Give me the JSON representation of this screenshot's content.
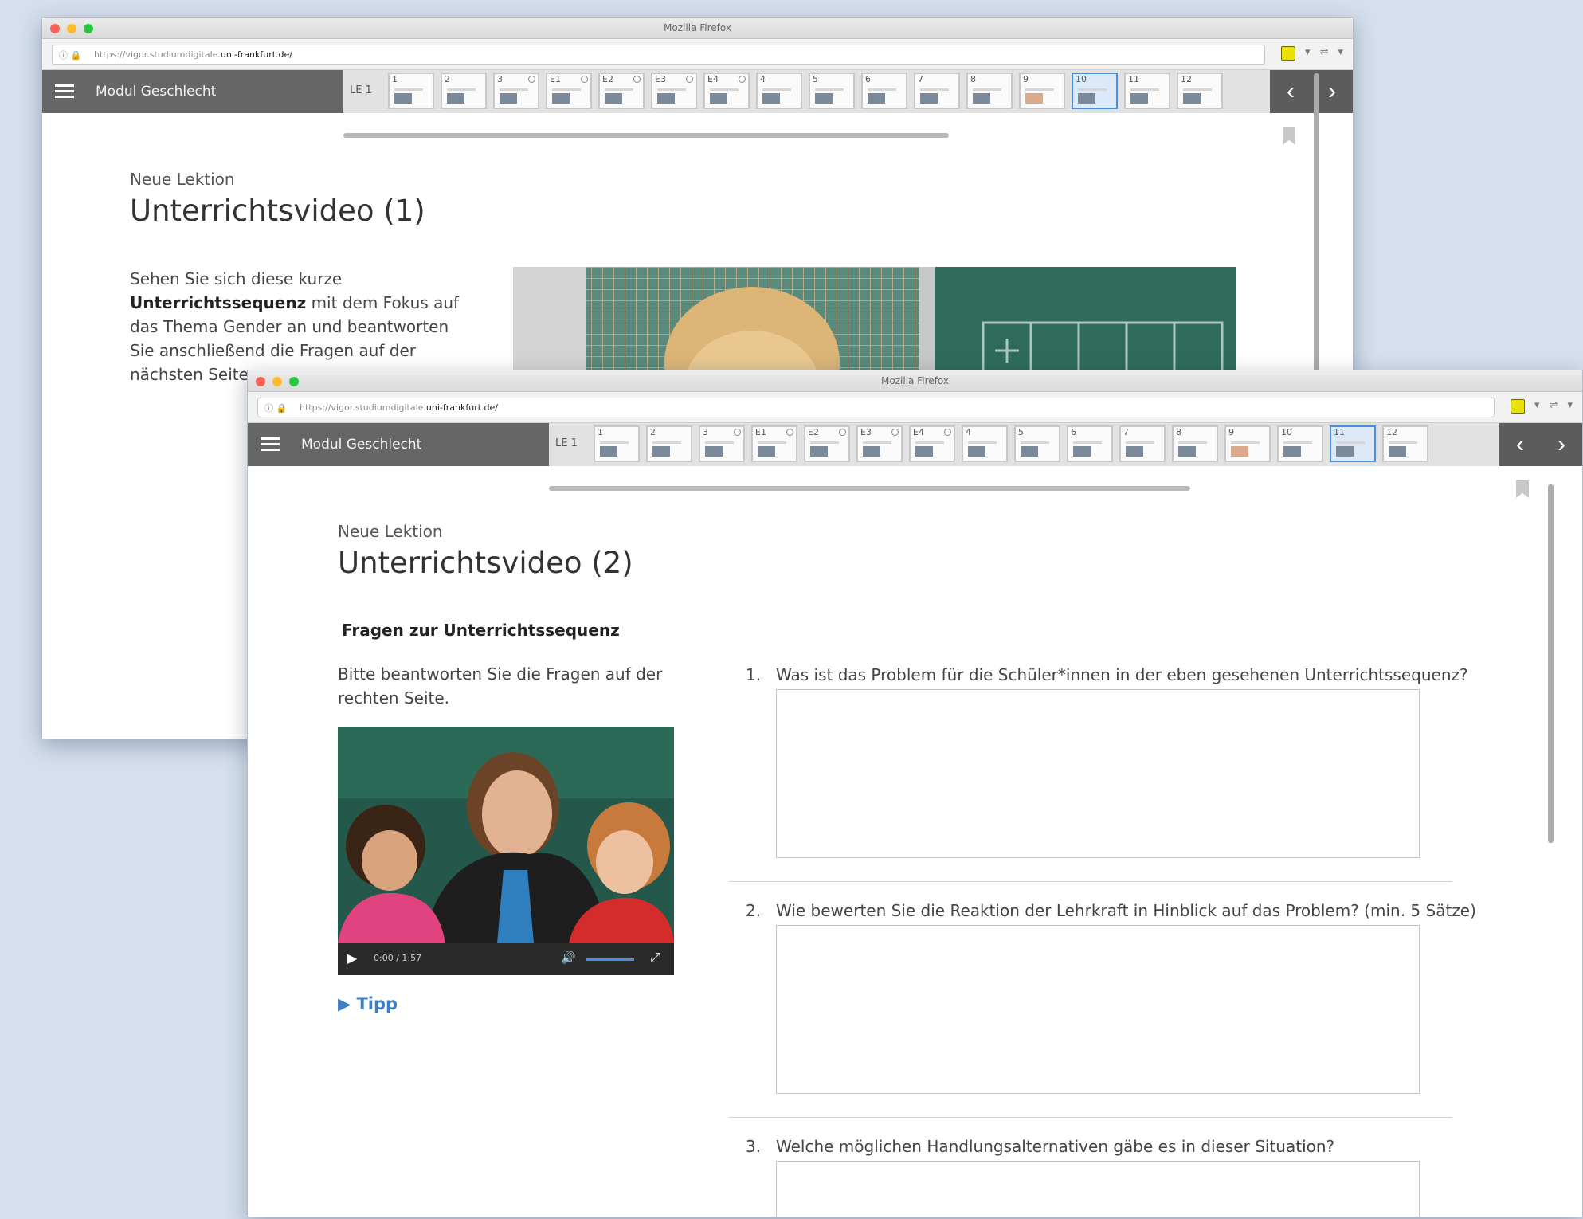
{
  "window1": {
    "browser_title": "Mozilla Firefox",
    "url_prefix": "https://vigor.studiumdigitale.",
    "url_host": "uni-frankfurt.de/",
    "module_title": "Modul Geschlecht",
    "le_label": "LE 1",
    "thumbnails": [
      "1",
      "2",
      "3",
      "E1",
      "E2",
      "E3",
      "E4",
      "4",
      "5",
      "6",
      "7",
      "8",
      "9",
      "10",
      "11",
      "12"
    ],
    "active_thumbnail": "10",
    "overline": "Neue Lektion",
    "title": "Unterrichtsvideo (1)",
    "intro_before": "Sehen Sie sich diese kurze ",
    "intro_bold": "Unterrichtssequenz",
    "intro_after": " mit dem Fokus auf das Thema Gender an und beantworten Sie anschließend die Fragen auf der nächsten Seite."
  },
  "window2": {
    "browser_title": "Mozilla Firefox",
    "url_prefix": "https://vigor.studiumdigitale.",
    "url_host": "uni-frankfurt.de/",
    "module_title": "Modul Geschlecht",
    "le_label": "LE 1",
    "thumbnails": [
      "1",
      "2",
      "3",
      "E1",
      "E2",
      "E3",
      "E4",
      "4",
      "5",
      "6",
      "7",
      "8",
      "9",
      "10",
      "11",
      "12"
    ],
    "active_thumbnail": "11",
    "overline": "Neue Lektion",
    "title": "Unterrichtsvideo (2)",
    "section_heading": "Fragen zur Unterrichtssequenz",
    "instructions": "Bitte beantworten Sie die Fragen auf der rechten Seite.",
    "video": {
      "time": "0:00 / 1:57"
    },
    "tipp": "Tipp",
    "questions": [
      {
        "num": "1.",
        "text": "Was ist das Problem für die Schüler*innen in der eben gesehenen Unterrichtssequenz?"
      },
      {
        "num": "2.",
        "text": "Wie bewerten Sie die Reaktion der Lehrkraft in Hinblick auf das Problem? (min. 5 Sätze)"
      },
      {
        "num": "3.",
        "text": "Welche möglichen Handlungsalternativen gäbe es in dieser Situation?"
      }
    ]
  },
  "colors": {
    "appbar": "#666666",
    "active_thumb": "#4a90d9",
    "tipp": "#3d7fc1"
  },
  "icons": [
    "menu-icon",
    "chevron-left-icon",
    "chevron-right-icon",
    "bookmark-icon",
    "play-icon",
    "volume-icon",
    "fullscreen-icon",
    "info-icon",
    "lock-icon",
    "note-icon",
    "reader-icon"
  ]
}
